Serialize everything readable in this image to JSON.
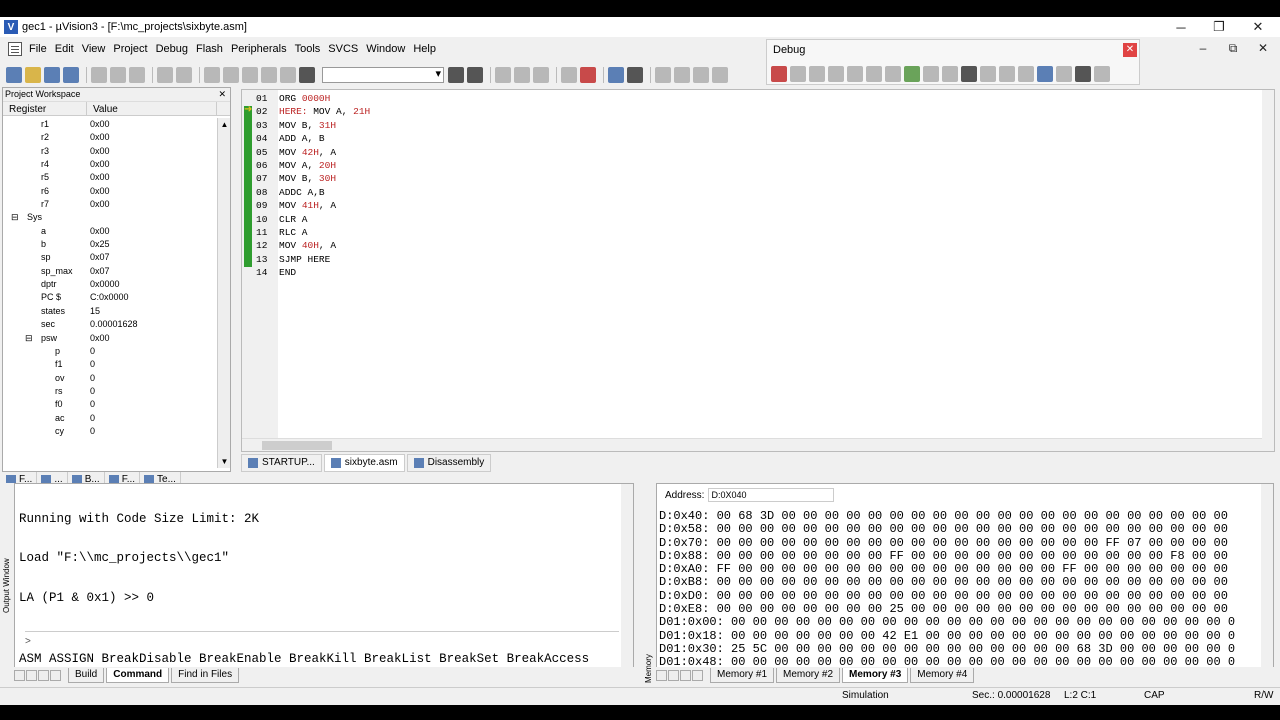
{
  "window": {
    "title": "gec1 - µVision3 - [F:\\mc_projects\\sixbyte.asm]",
    "controls": [
      "─",
      "❐",
      "✕"
    ]
  },
  "menu": [
    "File",
    "Edit",
    "View",
    "Project",
    "Debug",
    "Flash",
    "Peripherals",
    "Tools",
    "SVCS",
    "Window",
    "Help"
  ],
  "mdi_controls": [
    "–",
    "⧉",
    "✕"
  ],
  "debug_toolbar": {
    "title": "Debug",
    "close": "✕"
  },
  "workspace": {
    "title": "Project Workspace",
    "close": "✕",
    "col_register": "Register",
    "col_value": "Value",
    "rows": [
      {
        "name": "r1",
        "value": "0x00",
        "indent": 2
      },
      {
        "name": "r2",
        "value": "0x00",
        "indent": 2
      },
      {
        "name": "r3",
        "value": "0x00",
        "indent": 2
      },
      {
        "name": "r4",
        "value": "0x00",
        "indent": 2
      },
      {
        "name": "r5",
        "value": "0x00",
        "indent": 2
      },
      {
        "name": "r6",
        "value": "0x00",
        "indent": 2
      },
      {
        "name": "r7",
        "value": "0x00",
        "indent": 2
      },
      {
        "name": "Sys",
        "value": "",
        "indent": 1,
        "expander": "⊟"
      },
      {
        "name": "a",
        "value": "0x00",
        "indent": 2
      },
      {
        "name": "b",
        "value": "0x25",
        "indent": 2
      },
      {
        "name": "sp",
        "value": "0x07",
        "indent": 2
      },
      {
        "name": "sp_max",
        "value": "0x07",
        "indent": 2
      },
      {
        "name": "dptr",
        "value": "0x0000",
        "indent": 2
      },
      {
        "name": "PC  $",
        "value": "C:0x0000",
        "indent": 2
      },
      {
        "name": "states",
        "value": "15",
        "indent": 2
      },
      {
        "name": "sec",
        "value": "0.00001628",
        "indent": 2
      },
      {
        "name": "psw",
        "value": "0x00",
        "indent": 2,
        "expander": "⊟"
      },
      {
        "name": "p",
        "value": "0",
        "indent": 3
      },
      {
        "name": "f1",
        "value": "0",
        "indent": 3
      },
      {
        "name": "ov",
        "value": "0",
        "indent": 3
      },
      {
        "name": "rs",
        "value": "0",
        "indent": 3
      },
      {
        "name": "f0",
        "value": "0",
        "indent": 3
      },
      {
        "name": "ac",
        "value": "0",
        "indent": 3
      },
      {
        "name": "cy",
        "value": "0",
        "indent": 3
      }
    ],
    "tabs": [
      "F...",
      "...",
      "B...",
      "F...",
      "Te..."
    ]
  },
  "editor": {
    "lines": [
      {
        "n": "01",
        "t": "ORG ",
        "r": "0000H",
        "t2": ""
      },
      {
        "n": "02",
        "t": "",
        "r": "HERE:",
        "t2": " MOV A, ",
        "r2": "21H"
      },
      {
        "n": "03",
        "t": "MOV B, ",
        "r": "31H",
        "t2": ""
      },
      {
        "n": "04",
        "t": "ADD A, B",
        "r": "",
        "t2": ""
      },
      {
        "n": "05",
        "t": "MOV ",
        "r": "42H",
        "t2": ", A"
      },
      {
        "n": "06",
        "t": "MOV A, ",
        "r": "20H",
        "t2": ""
      },
      {
        "n": "07",
        "t": "MOV B, ",
        "r": "30H",
        "t2": ""
      },
      {
        "n": "08",
        "t": "ADDC A,B",
        "r": "",
        "t2": ""
      },
      {
        "n": "09",
        "t": "MOV ",
        "r": "41H",
        "t2": ", A"
      },
      {
        "n": "10",
        "t": "CLR A",
        "r": "",
        "t2": ""
      },
      {
        "n": "11",
        "t": "RLC A",
        "r": "",
        "t2": ""
      },
      {
        "n": "12",
        "t": "MOV ",
        "r": "40H",
        "t2": ", A"
      },
      {
        "n": "13",
        "t": "SJMP HERE",
        "r": "",
        "t2": ""
      },
      {
        "n": "14",
        "t": "END",
        "r": "",
        "t2": ""
      }
    ],
    "tabs": [
      "STARTUP...",
      "sixbyte.asm",
      "Disassembly"
    ]
  },
  "output": {
    "lines": [
      "Running with Code Size Limit: 2K",
      "Load \"F:\\\\mc_projects\\\\gec1\"",
      "LA (P1 & 0x1) >> 0"
    ],
    "prompt": ">",
    "commands": "ASM ASSIGN BreakDisable BreakEnable BreakKill BreakList BreakSet BreakAccess",
    "side_label": "Output Window",
    "tabs": [
      "Build",
      "Command",
      "Find in Files"
    ]
  },
  "memory": {
    "address_label": "Address:",
    "address_value": "D:0X040",
    "rows": [
      "D:0x40: 00 68 3D 00 00 00 00 00 00 00 00 00 00 00 00 00 00 00 00 00 00 00 00 00",
      "D:0x58: 00 00 00 00 00 00 00 00 00 00 00 00 00 00 00 00 00 00 00 00 00 00 00 00",
      "D:0x70: 00 00 00 00 00 00 00 00 00 00 00 00 00 00 00 00 00 00 FF 07 00 00 00 00",
      "D:0x88: 00 00 00 00 00 00 00 00 FF 00 00 00 00 00 00 00 00 00 00 00 00 F8 00 00",
      "D:0xA0: FF 00 00 00 00 00 00 00 00 00 00 00 00 00 00 00 FF 00 00 00 00 00 00 00",
      "D:0xB8: 00 00 00 00 00 00 00 00 00 00 00 00 00 00 00 00 00 00 00 00 00 00 00 00",
      "D:0xD0: 00 00 00 00 00 00 00 00 00 00 00 00 00 00 00 00 00 00 00 00 00 00 00 00",
      "D:0xE8: 00 00 00 00 00 00 00 00 25 00 00 00 00 00 00 00 00 00 00 00 00 00 00 00",
      "D01:0x00: 00 00 00 00 00 00 00 00 00 00 00 00 00 00 00 00 00 00 00 00 00 00 00 0",
      "D01:0x18: 00 00 00 00 00 00 00 42 E1 00 00 00 00 00 00 00 00 00 00 00 00 00 00 0",
      "D01:0x30: 25 5C 00 00 00 00 00 00 00 00 00 00 00 00 00 00 68 3D 00 00 00 00 00 0",
      "D01:0x48: 00 00 00 00 00 00 00 00 00 00 00 00 00 00 00 00 00 00 00 00 00 00 00 0"
    ],
    "side_label": "Memory",
    "tabs": [
      "Memory #1",
      "Memory #2",
      "Memory #3",
      "Memory #4"
    ]
  },
  "status": {
    "mode": "Simulation",
    "time": "Sec.: 0.00001628",
    "position": "L:2 C:1",
    "caps": "CAP",
    "rw": "R/W"
  }
}
